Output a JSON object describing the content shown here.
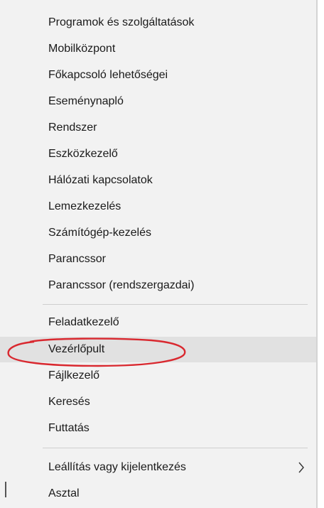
{
  "menu": {
    "groups": [
      {
        "items": [
          {
            "label": "Programok és szolgáltatások"
          },
          {
            "label": "Mobilközpont"
          },
          {
            "label": "Főkapcsoló lehetőségei"
          },
          {
            "label": "Eseménynapló"
          },
          {
            "label": "Rendszer"
          },
          {
            "label": "Eszközkezelő"
          },
          {
            "label": "Hálózati kapcsolatok"
          },
          {
            "label": "Lemezkezelés"
          },
          {
            "label": "Számítógép-kezelés"
          },
          {
            "label": "Parancssor"
          },
          {
            "label": "Parancssor (rendszergazdai)"
          }
        ]
      },
      {
        "items": [
          {
            "label": "Feladatkezelő"
          },
          {
            "label": "Vezérlőpult"
          },
          {
            "label": "Fájlkezelő"
          },
          {
            "label": "Keresés"
          },
          {
            "label": "Futtatás"
          }
        ]
      },
      {
        "items": [
          {
            "label": "Leállítás vagy kijelentkezés",
            "submenu_icon": "chevron-right-icon"
          },
          {
            "label": "Asztal"
          }
        ]
      }
    ],
    "highlighted_item": "Vezérlőpult",
    "annotation": {
      "shape": "ellipse",
      "color": "#d9282f",
      "target": "Vezérlőpult"
    }
  }
}
